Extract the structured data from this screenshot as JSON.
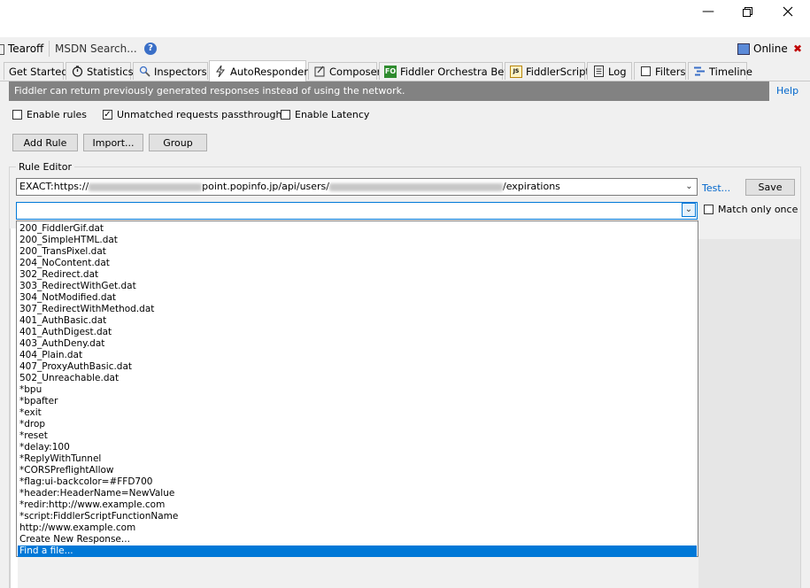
{
  "window": {
    "min_icon": "minimize-icon",
    "max_icon": "restore-icon",
    "close_icon": "close-icon"
  },
  "toolbar": {
    "tearoff": "Tearoff",
    "msdn_search": "MSDN Search...",
    "help_icon": "help-circle-icon",
    "online": "Online",
    "close_x": "✖"
  },
  "tabs": [
    {
      "label": "Get Started",
      "icon": "none"
    },
    {
      "label": "Statistics",
      "icon": "stopwatch-icon"
    },
    {
      "label": "Inspectors",
      "icon": "inspectors-icon"
    },
    {
      "label": "AutoResponder",
      "icon": "lightning-icon"
    },
    {
      "label": "Composer",
      "icon": "composer-icon"
    },
    {
      "label": "Fiddler Orchestra Beta",
      "icon": "fo-icon",
      "badge": "FO"
    },
    {
      "label": "FiddlerScript",
      "icon": "script-icon",
      "badge": "JS"
    },
    {
      "label": "Log",
      "icon": "log-icon"
    },
    {
      "label": "Filters",
      "icon": "checkbox-icon"
    },
    {
      "label": "Timeline",
      "icon": "timeline-icon"
    }
  ],
  "info": {
    "message": "Fiddler can return previously generated responses instead of using the network.",
    "help": "Help"
  },
  "options": {
    "enable_rules": "Enable rules",
    "enable_rules_checked": false,
    "unmatched": "Unmatched requests passthrough",
    "unmatched_checked": true,
    "enable_latency": "Enable Latency",
    "enable_latency_checked": false
  },
  "buttons": {
    "add_rule": "Add Rule",
    "import": "Import...",
    "group": "Group"
  },
  "rule_editor": {
    "label": "Rule Editor",
    "match_prefix": "EXACT:https://",
    "match_mid": "point.popinfo.jp/api/users/",
    "match_suffix": "/expirations",
    "test": "Test...",
    "save": "Save",
    "action_value": "",
    "match_only_once": "Match only once",
    "match_only_once_checked": false
  },
  "dropdown": {
    "items": [
      "200_FiddlerGif.dat",
      "200_SimpleHTML.dat",
      "200_TransPixel.dat",
      "204_NoContent.dat",
      "302_Redirect.dat",
      "303_RedirectWithGet.dat",
      "304_NotModified.dat",
      "307_RedirectWithMethod.dat",
      "401_AuthBasic.dat",
      "401_AuthDigest.dat",
      "403_AuthDeny.dat",
      "404_Plain.dat",
      "407_ProxyAuthBasic.dat",
      "502_Unreachable.dat",
      "*bpu",
      "*bpafter",
      "*exit",
      "*drop",
      "*reset",
      "*delay:100",
      "*ReplyWithTunnel",
      "*CORSPreflightAllow",
      "*flag:ui-backcolor=#FFD700",
      "*header:HeaderName=NewValue",
      "*redir:http://www.example.com",
      "*script:FiddlerScriptFunctionName",
      "http://www.example.com",
      "Create New Response...",
      "Find a file..."
    ],
    "selected_index": 28
  },
  "colors": {
    "selection": "#0078d7",
    "infobar": "#828282",
    "link": "#0066cc"
  }
}
